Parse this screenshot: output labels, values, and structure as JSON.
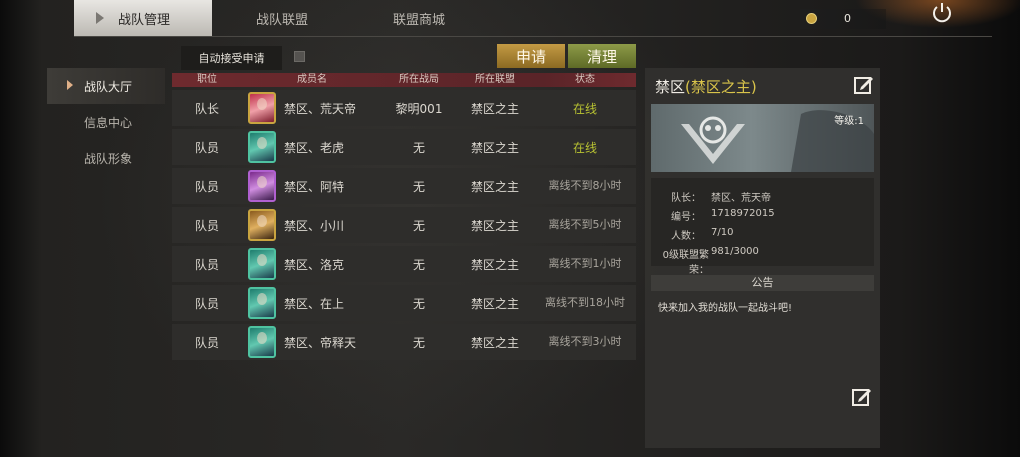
{
  "top_tabs": [
    {
      "label": "战队管理",
      "active": true
    },
    {
      "label": "战队联盟",
      "active": false
    },
    {
      "label": "联盟商城",
      "active": false
    }
  ],
  "currency": {
    "icon": "coin-icon",
    "value": "0"
  },
  "sidebar": {
    "items": [
      {
        "label": "战队大厅",
        "active": true
      },
      {
        "label": "信息中心",
        "active": false
      },
      {
        "label": "战队形象",
        "active": false
      }
    ]
  },
  "toolbar": {
    "auto_accept_label": "自动接受申请",
    "auto_accept_checked": false,
    "apply_label": "申请",
    "clear_label": "清理"
  },
  "table": {
    "headers": [
      "职位",
      "成员名",
      "所在战局",
      "所在联盟",
      "状态"
    ],
    "rows": [
      {
        "role": "队长",
        "name": "禁区、荒天帝",
        "match": "黎明001",
        "alliance": "禁区之主",
        "status": "在线",
        "online": true
      },
      {
        "role": "队员",
        "name": "禁区、老虎",
        "match": "无",
        "alliance": "禁区之主",
        "status": "在线",
        "online": true
      },
      {
        "role": "队员",
        "name": "禁区、阿特",
        "match": "无",
        "alliance": "禁区之主",
        "status": "离线不到8小时",
        "online": false
      },
      {
        "role": "队员",
        "name": "禁区、小川",
        "match": "无",
        "alliance": "禁区之主",
        "status": "离线不到5小时",
        "online": false
      },
      {
        "role": "队员",
        "name": "禁区、洛克",
        "match": "无",
        "alliance": "禁区之主",
        "status": "离线不到1小时",
        "online": false
      },
      {
        "role": "队员",
        "name": "禁区、在上",
        "match": "无",
        "alliance": "禁区之主",
        "status": "离线不到18小时",
        "online": false
      },
      {
        "role": "队员",
        "name": "禁区、帝释天",
        "match": "无",
        "alliance": "禁区之主",
        "status": "离线不到3小时",
        "online": false
      }
    ]
  },
  "team": {
    "name": "禁区",
    "alliance_tag": "(禁区之主)",
    "level": "等级:1",
    "info": [
      {
        "key": "队长：",
        "value": "禁区、荒天帝"
      },
      {
        "key": "编号：",
        "value": "1718972015"
      },
      {
        "key": "人数：",
        "value": "7/10"
      },
      {
        "key": "0级联盟繁荣：",
        "value": "981/3000"
      }
    ],
    "notice_title": "公告",
    "notice_text": "快来加入我的战队一起战斗吧!"
  },
  "colors": {
    "online": "#b8c232",
    "accent_gold": "#c39a44",
    "accent_green": "#8d9a48",
    "header_red": "#6e2a2e"
  }
}
